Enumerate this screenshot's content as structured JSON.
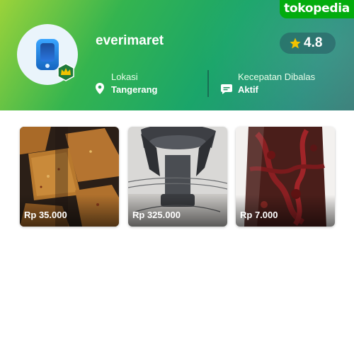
{
  "brand": {
    "label": "tokopedia"
  },
  "shop": {
    "name": "everimaret",
    "rating": "4.8",
    "location_label": "Lokasi",
    "location_value": "Tangerang",
    "response_label": "Kecepatan Dibalas",
    "response_value": "Aktif"
  },
  "products": [
    {
      "price": "Rp 35.000"
    },
    {
      "price": "Rp 325.000"
    },
    {
      "price": "Rp 7.000"
    }
  ],
  "colors": {
    "brand_green": "#03ac0e",
    "star": "#f2c200"
  },
  "icons": [
    "crown-badge-icon",
    "star-icon",
    "location-pin-icon",
    "chat-icon"
  ]
}
